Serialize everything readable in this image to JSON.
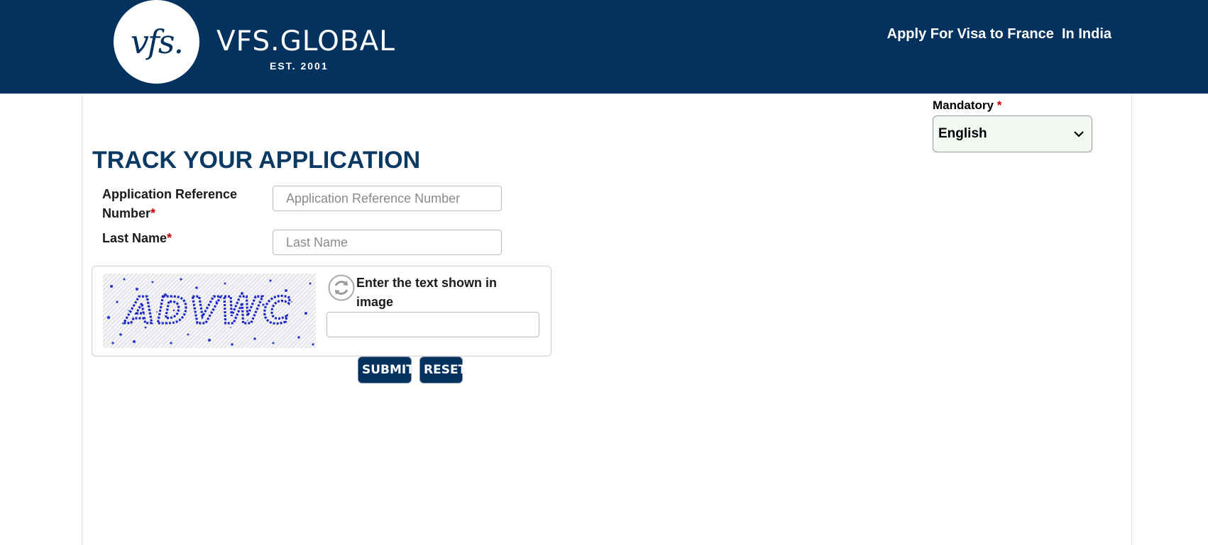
{
  "header": {
    "logo_text": "vfs.",
    "brand_name": "VFS.GLOBAL",
    "brand_est": "EST. 2001",
    "title": "Apply For Visa to France  In India",
    "background_color": "#02325d"
  },
  "language": {
    "label": "Mandatory",
    "required_mark": "*",
    "selected": "English"
  },
  "page_title": "TRACK YOUR APPLICATION",
  "form": {
    "ref_label_line1": "Application Reference",
    "ref_label_line2": "Number",
    "ref_placeholder": "Application Reference Number",
    "ref_value": "",
    "lastname_label": "Last Name",
    "lastname_placeholder": "Last Name",
    "lastname_value": "",
    "required_mark": "*"
  },
  "captcha": {
    "image_text": "ADVWC",
    "label": "Enter the text shown in image",
    "value": "",
    "refresh_icon": "refresh-icon"
  },
  "buttons": {
    "submit_label": "SUBMIT",
    "reset_label": "RESET"
  }
}
